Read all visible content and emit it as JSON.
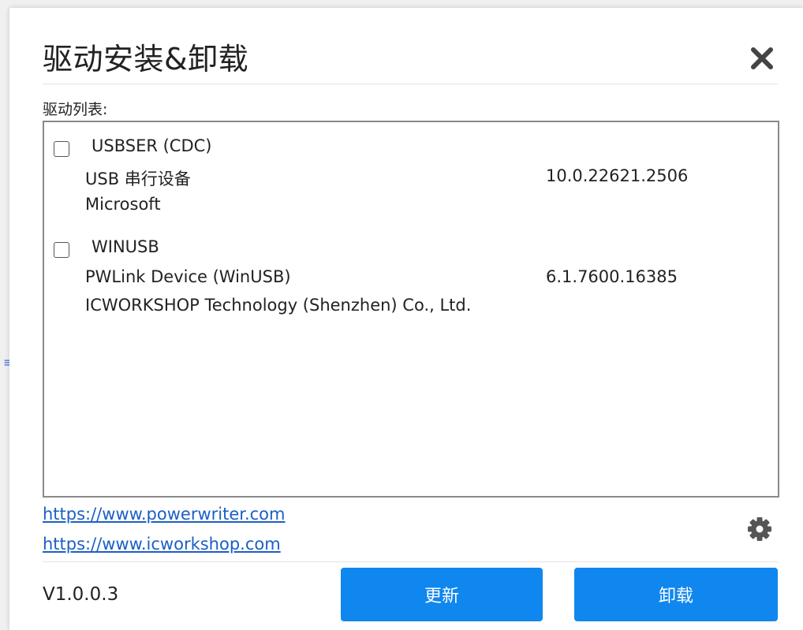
{
  "side_mark": "≡",
  "dialog": {
    "title": "驱动安装&卸载",
    "list_label": "驱动列表:"
  },
  "drivers": [
    {
      "name": "USBSER (CDC)",
      "description": "USB 串行设备",
      "version": "10.0.22621.2506",
      "vendor": "Microsoft",
      "checked": false
    },
    {
      "name": "WINUSB",
      "description": "PWLink Device (WinUSB)",
      "version": "6.1.7600.16385",
      "vendor": "ICWORKSHOP Technology (Shenzhen) Co., Ltd.",
      "checked": false
    }
  ],
  "links": [
    "https://www.powerwriter.com",
    "https://www.icworkshop.com"
  ],
  "footer": {
    "version": "V1.0.0.3",
    "update_label": "更新",
    "uninstall_label": "卸载"
  },
  "icons": {
    "close": "close-icon",
    "settings": "gear-icon"
  },
  "colors": {
    "accent": "#0f87ef",
    "link": "#1b5fc6",
    "close_icon": "#444444",
    "gear_icon": "#555555"
  }
}
